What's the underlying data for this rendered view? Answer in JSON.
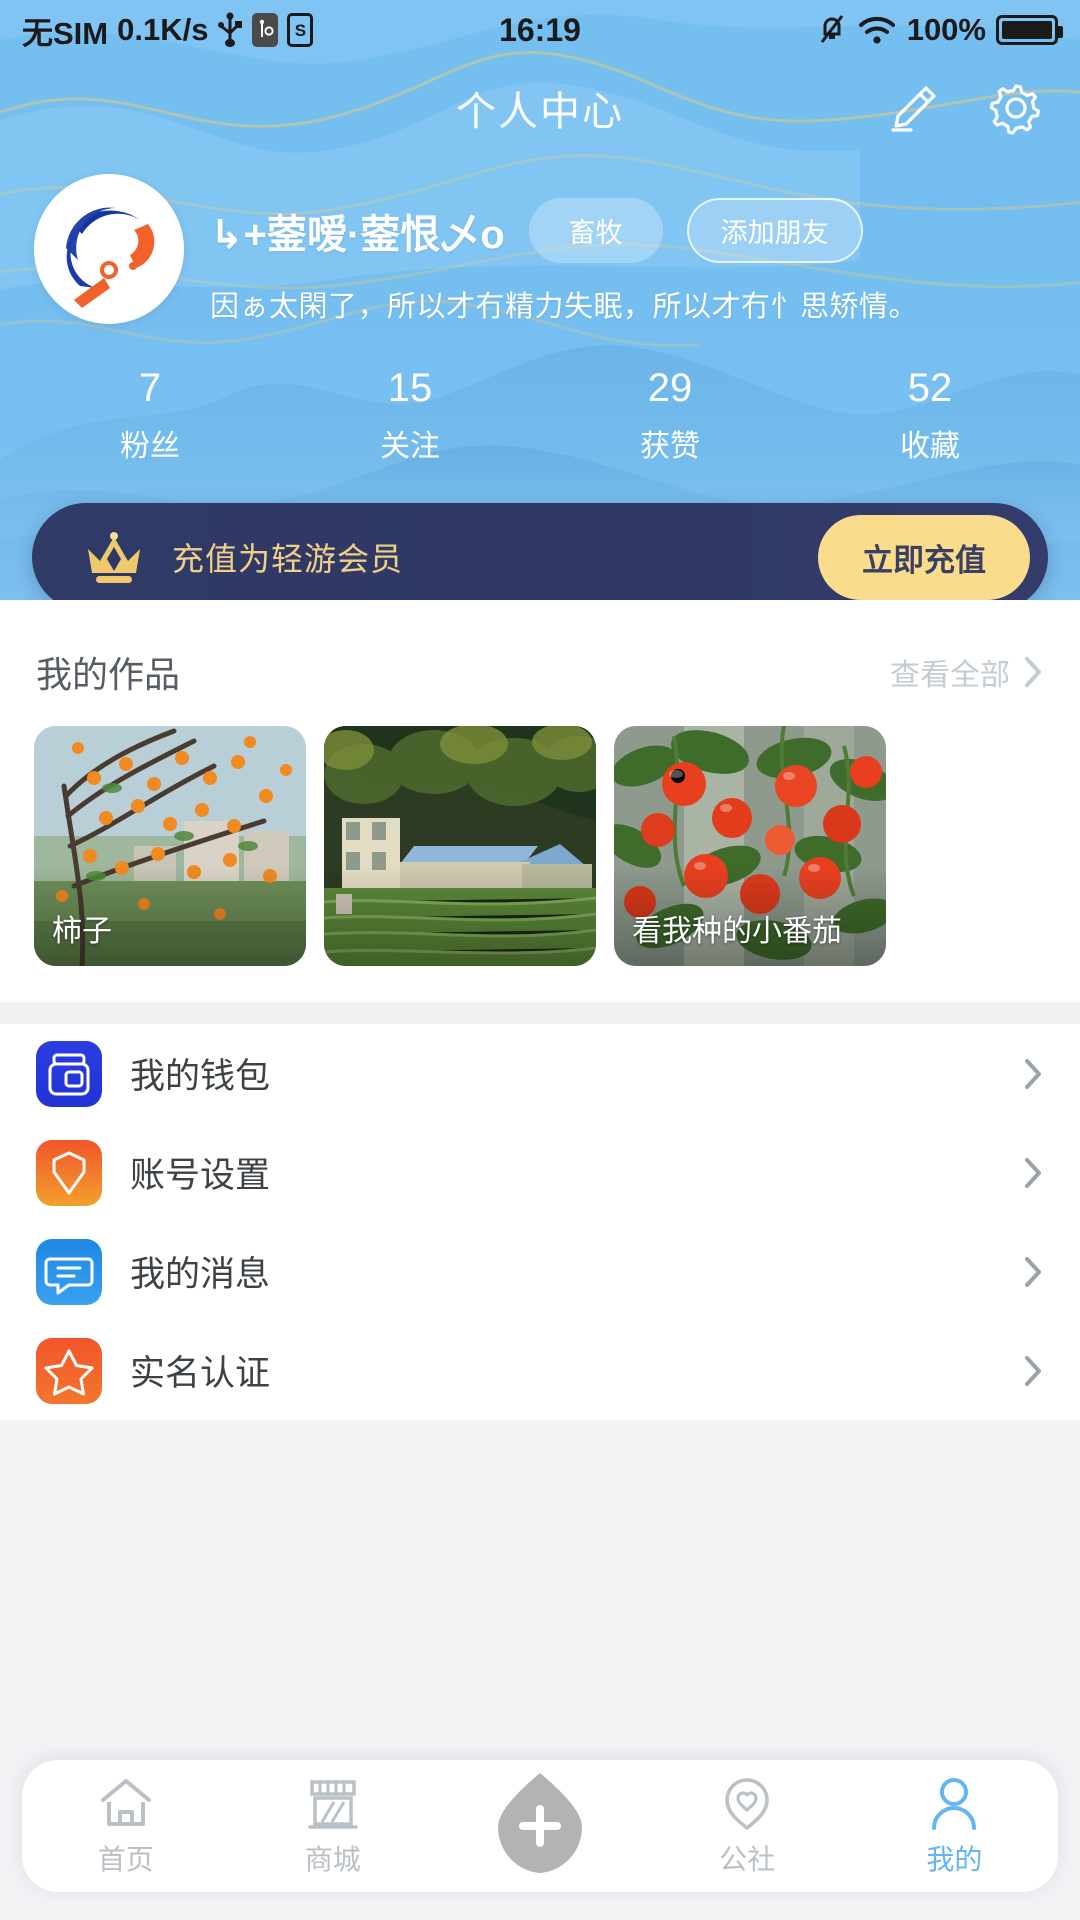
{
  "status_bar": {
    "carrier": "无SIM",
    "network_speed": "0.1K/s",
    "icons": [
      "usb-icon",
      "usb-settings-icon",
      "sim-s-icon"
    ],
    "time": "16:19",
    "right_icons": [
      "mute-icon",
      "wifi-icon"
    ],
    "battery_percent": "100%"
  },
  "header": {
    "title": "个人中心",
    "edit_icon": "pencil-icon",
    "settings_icon": "gear-icon"
  },
  "profile": {
    "avatar_alt": "user-avatar",
    "username": "↳+蓥嗳·蓥恨乄o",
    "category_tag": "畜牧",
    "add_friend": "添加朋友",
    "bio": "因ぁ太閑了，所以才冇精力失眠，所以才冇忄思矫情。"
  },
  "stats": [
    {
      "value": "7",
      "label": "粉丝"
    },
    {
      "value": "15",
      "label": "关注"
    },
    {
      "value": "29",
      "label": "获赞"
    },
    {
      "value": "52",
      "label": "收藏"
    }
  ],
  "vip_banner": {
    "icon": "crown-icon",
    "text": "充值为轻游会员",
    "button": "立即充值",
    "bg_color": "#303a66",
    "accent_color": "#f9dd8d"
  },
  "works": {
    "title": "我的作品",
    "view_all": "查看全部",
    "chevron_icon": "chevron-right-icon",
    "items": [
      {
        "caption": "柿子",
        "image_alt": "persimmon-tree-photo"
      },
      {
        "caption": "",
        "image_alt": "village-farm-photo"
      },
      {
        "caption": "看我种的小番茄",
        "image_alt": "cherry-tomato-photo"
      }
    ]
  },
  "menu": [
    {
      "label": "我的钱包",
      "icon": "wallet-icon",
      "color": "#2b3ce0",
      "color2": "#2b3ce0"
    },
    {
      "label": "账号设置",
      "icon": "diamond-icon",
      "color": "#f2552c",
      "color2": "#f3a02c"
    },
    {
      "label": "我的消息",
      "icon": "message-icon",
      "color": "#1f88e5",
      "color2": "#1f88e5"
    },
    {
      "label": "实名认证",
      "icon": "star-icon",
      "color": "#f2552c",
      "color2": "#f37b2c"
    }
  ],
  "tabbar": [
    {
      "label": "首页",
      "icon": "home-icon",
      "active": false
    },
    {
      "label": "商城",
      "icon": "shop-icon",
      "active": false
    },
    {
      "label": "",
      "icon": "plus-icon",
      "active": false
    },
    {
      "label": "公社",
      "icon": "heart-pin-icon",
      "active": false
    },
    {
      "label": "我的",
      "icon": "person-icon",
      "active": true
    }
  ],
  "theme": {
    "hero_blue": "#74bef0",
    "active_blue": "#63b6f0",
    "muted_gray": "#b9c0c6"
  }
}
